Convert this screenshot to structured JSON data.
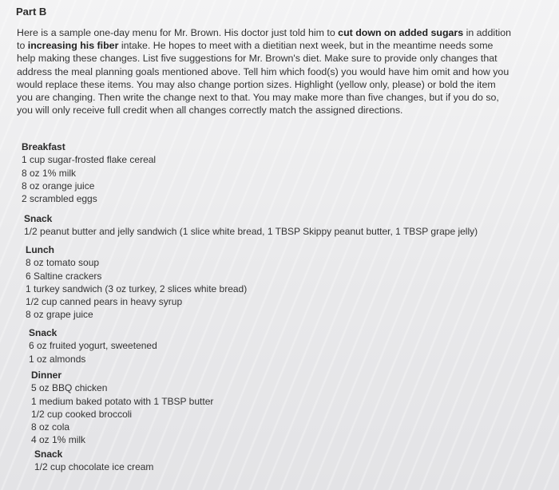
{
  "part_title": "Part B",
  "instructions": {
    "seg1": "Here is a sample one-day menu for Mr. Brown. His doctor just told him to ",
    "bold1": "cut down on added sugars",
    "seg2": " in addition to ",
    "bold2": "increasing his fiber",
    "seg3": " intake. He hopes to meet with a dietitian next week, but in the meantime needs some help making these changes. List five suggestions for Mr. Brown's diet. Make sure to provide only changes that address the meal planning goals mentioned above. Tell him which food(s) you would have him omit and how you would replace these items. You may also change portion sizes. Highlight (yellow only, please) or bold the item you are changing. Then write the change next to that. You may make more than five changes, but if you do so, you will only receive full credit when all changes correctly match the assigned directions."
  },
  "menu": {
    "breakfast": {
      "heading": "Breakfast",
      "items": [
        "1 cup sugar-frosted flake cereal",
        "8 oz 1% milk",
        "8 oz orange juice",
        "2 scrambled eggs"
      ]
    },
    "snack1": {
      "heading": "Snack",
      "items": [
        "1/2 peanut butter and jelly sandwich (1 slice white bread, 1 TBSP Skippy peanut butter, 1 TBSP grape jelly)"
      ]
    },
    "lunch": {
      "heading": "Lunch",
      "items": [
        "8 oz tomato soup",
        "6 Saltine crackers",
        "1 turkey sandwich (3 oz turkey, 2 slices white bread)",
        "1/2 cup canned pears in heavy syrup",
        "8 oz grape juice"
      ]
    },
    "snack2": {
      "heading": "Snack",
      "items": [
        "6 oz fruited yogurt, sweetened",
        "1 oz almonds"
      ]
    },
    "dinner": {
      "heading": "Dinner",
      "items": [
        "5 oz BBQ chicken",
        "1 medium baked potato with 1 TBSP butter",
        "1/2 cup cooked broccoli",
        "8 oz cola",
        "4 oz 1% milk"
      ]
    },
    "snack3": {
      "heading": "Snack",
      "items": [
        "1/2 cup chocolate ice cream"
      ]
    }
  }
}
